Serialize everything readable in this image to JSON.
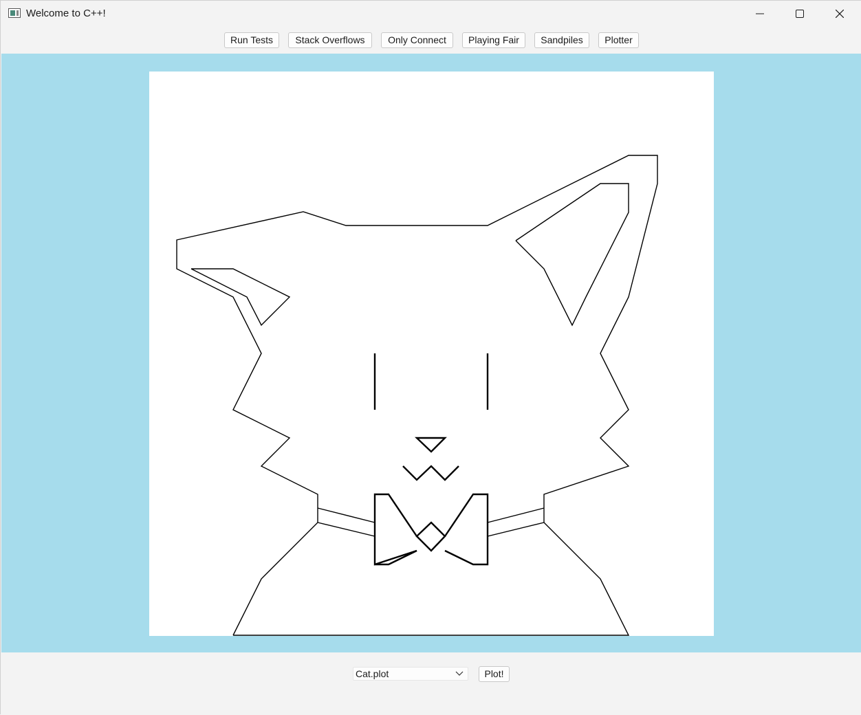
{
  "window": {
    "title": "Welcome to C++!",
    "controls": [
      "minimize",
      "maximize",
      "close"
    ]
  },
  "toolbar": {
    "buttons": [
      {
        "label": "Run Tests"
      },
      {
        "label": "Stack Overflows"
      },
      {
        "label": "Only Connect"
      },
      {
        "label": "Playing Fair"
      },
      {
        "label": "Sandpiles"
      },
      {
        "label": "Plotter"
      }
    ]
  },
  "canvas": {
    "background": "#a6dcec",
    "drawing_color": "#000000",
    "drawing": "cat line drawing with bow tie"
  },
  "bottom": {
    "plot_file_select": {
      "selected": "Cat.plot"
    },
    "plot_button": "Plot!"
  },
  "icons": {
    "app": "app-window-icon",
    "dropdown": "chevron-down-icon"
  }
}
